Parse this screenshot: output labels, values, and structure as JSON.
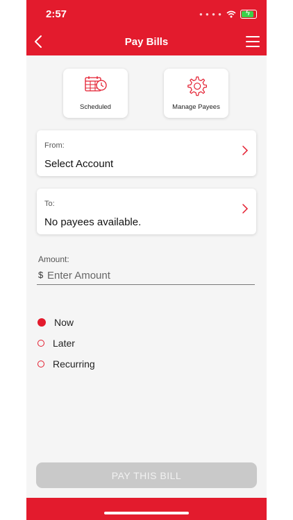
{
  "status": {
    "time": "2:57"
  },
  "header": {
    "title": "Pay Bills"
  },
  "tiles": [
    {
      "label": "Scheduled"
    },
    {
      "label": "Manage Payees"
    }
  ],
  "from": {
    "label": "From:",
    "value": "Select Account"
  },
  "to": {
    "label": "To:",
    "value": "No payees available."
  },
  "amount": {
    "label": "Amount:",
    "currency": "$",
    "placeholder": "Enter Amount"
  },
  "schedule_options": [
    {
      "label": "Now",
      "selected": true
    },
    {
      "label": "Later",
      "selected": false
    },
    {
      "label": "Recurring",
      "selected": false
    }
  ],
  "pay_button": {
    "label": "PAY THIS BILL"
  },
  "colors": {
    "brand": "#e31b2d",
    "disabled_button": "#c9c9c9",
    "background": "#f5f5f5"
  }
}
